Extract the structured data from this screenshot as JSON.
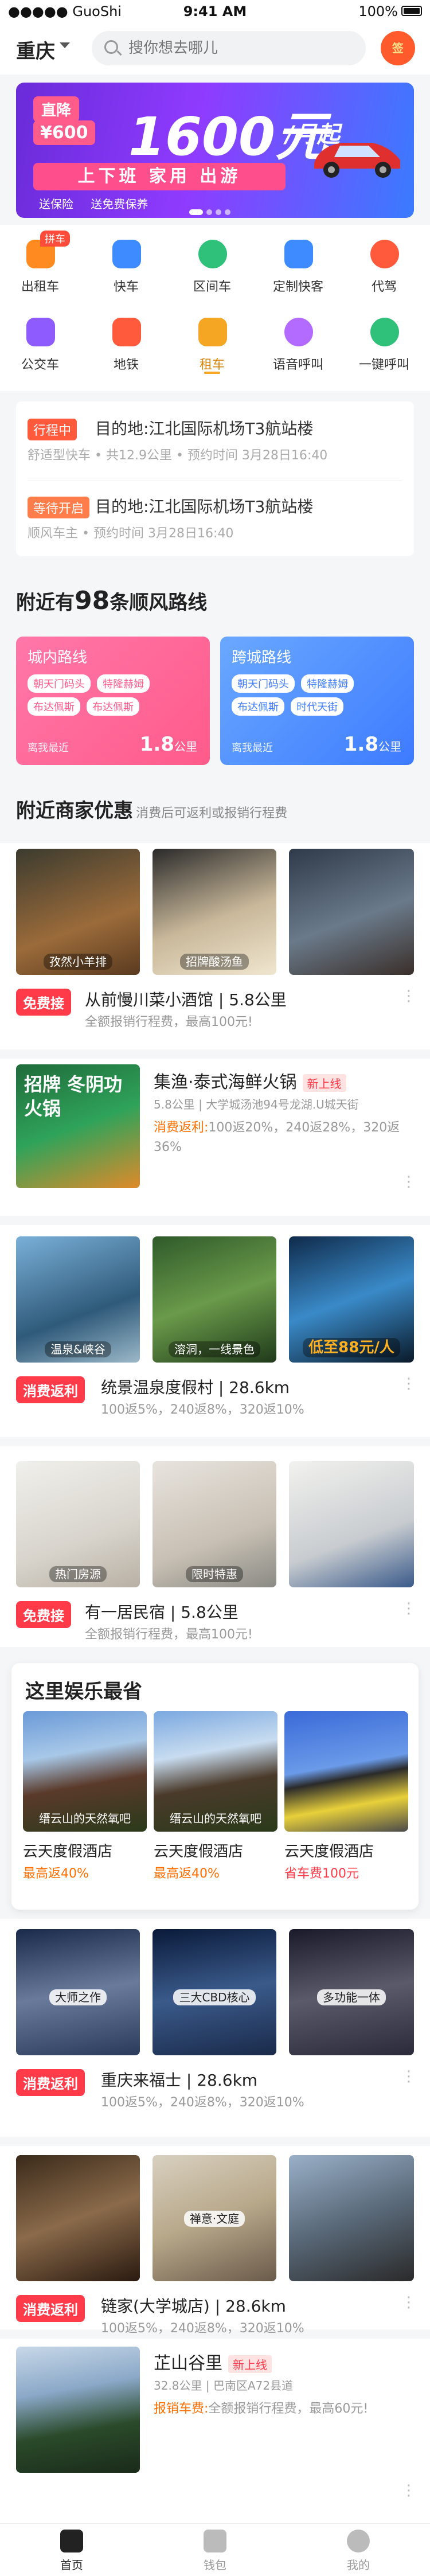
{
  "status": {
    "carrier": "GuoShi",
    "time": "9:41 AM",
    "battery": "100%"
  },
  "header": {
    "city": "重庆",
    "search_placeholder": "搜你想去哪儿",
    "redpacket_label": "签"
  },
  "banner": {
    "tag1": "直降",
    "tag2": "¥600",
    "headline": "1600元",
    "unit": "/月起",
    "slogan": "上下班 家用 出游",
    "perks": [
      "送保险",
      "送免费保养"
    ]
  },
  "services": [
    {
      "label": "出租车",
      "tag": "拼车"
    },
    {
      "label": "快车"
    },
    {
      "label": "区间车"
    },
    {
      "label": "定制快客"
    },
    {
      "label": "代驾"
    },
    {
      "label": "公交车"
    },
    {
      "label": "地铁"
    },
    {
      "label": "租车"
    },
    {
      "label": "语音呼叫"
    },
    {
      "label": "一键呼叫"
    }
  ],
  "trips": [
    {
      "status": "行程中",
      "dest": "目的地:江北国际机场T3航站楼",
      "meta": "舒适型快车 • 共12.9公里 • 预约时间 3月28日16:40"
    },
    {
      "status": "等待开启",
      "dest": "目的地:江北国际机场T3航站楼",
      "meta": "顺风车主 • 预约时间 3月28日16:40"
    }
  ],
  "routes": {
    "title_pre": "附近有",
    "count": "98",
    "title_post": "条顺风路线",
    "items": [
      {
        "title": "城内路线",
        "chips": [
          "朝天门码头",
          "特隆赫姆",
          "布达佩斯",
          "布达佩斯"
        ],
        "foot": "离我最近",
        "dist": "1.8",
        "unit": "公里"
      },
      {
        "title": "跨城路线",
        "chips": [
          "朝天门码头",
          "特隆赫姆",
          "布达佩斯",
          "时代天街"
        ],
        "foot": "离我最近",
        "dist": "1.8",
        "unit": "公里"
      }
    ]
  },
  "merchants": {
    "title": "附近商家优惠",
    "subtitle": "消费后可返利或报销行程费",
    "m1": {
      "captions": [
        "孜然小羊排",
        "招牌酸汤鱼"
      ],
      "badge": "免费接",
      "name": "从前慢川菜小酒馆 | 5.8公里",
      "desc": "全额报销行程费，最高100元!"
    },
    "m2": {
      "name": "集渔·泰式海鲜火锅",
      "new": "新上线",
      "addr": "5.8公里 | 大学城汤池94号龙湖.U城天街",
      "rebate_label": "消费返利:",
      "rebate": "100返20%，240返28%，320返36%",
      "poster": "招牌 冬阴功火锅"
    },
    "m3": {
      "captions": [
        "温泉&峡谷",
        "溶洞，一线景色",
        "低至88元/人"
      ],
      "badge": "消费返利",
      "name": "统景温泉度假村 | 28.6km",
      "desc": "100返5%，240返8%，320返10%"
    },
    "m4": {
      "captions": [
        "热门房源",
        "限时特惠"
      ],
      "badge": "免费接",
      "name": "有一居民宿 | 5.8公里",
      "desc": "全额报销行程费，最高100元!"
    },
    "m5": {
      "captions": [
        "大师之作",
        "三大CBD核心",
        "多功能一体"
      ],
      "badge": "消费返利",
      "name": "重庆来福士 | 28.6km",
      "desc": "100返5%，240返8%，320返10%"
    },
    "m6": {
      "captions": [
        "禅意·文庭"
      ],
      "badge": "消费返利",
      "name": "链家(大学城店) | 28.6km",
      "desc": "100返5%，240返8%，320返10%"
    },
    "m7": {
      "name": "芷山谷里",
      "new": "新上线",
      "addr": "32.8公里 | 巴南区A72县道",
      "rebate_label": "报销车费:",
      "rebate": "全额报销行程费，最高60元!"
    }
  },
  "entertainment": {
    "title": "这里娱乐最省",
    "items": [
      {
        "caption": "缙云山的天然氧吧",
        "name": "云天度假酒店",
        "price": "最高返40%"
      },
      {
        "caption": "缙云山的天然氧吧",
        "name": "云天度假酒店",
        "price": "最高返40%"
      },
      {
        "caption": "",
        "name": "云天度假酒店",
        "price": "省车费100元"
      }
    ]
  },
  "tabbar": [
    {
      "label": "首页"
    },
    {
      "label": "钱包"
    },
    {
      "label": "我的"
    }
  ],
  "colors": {
    "accent": "#ff3b4a",
    "orange": "#f5a623",
    "purple": "#7a31ff"
  }
}
